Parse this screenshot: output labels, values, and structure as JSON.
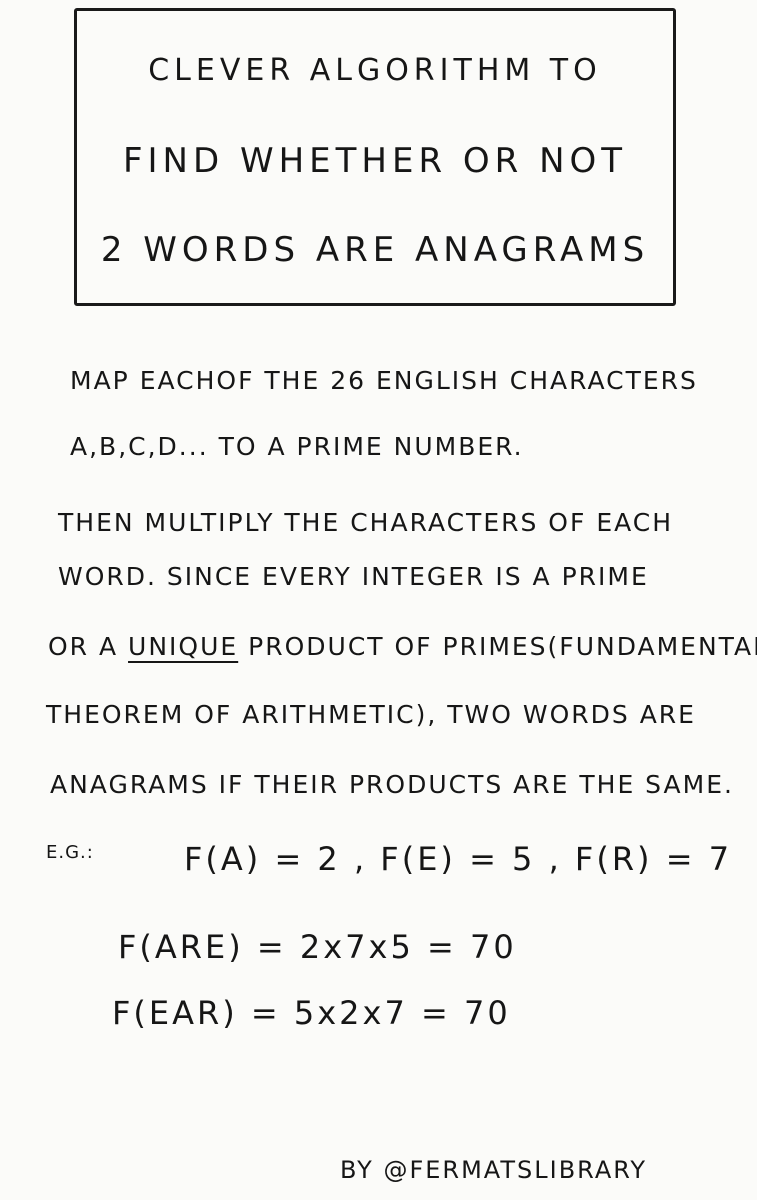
{
  "title": {
    "line1": "CLEVER ALGORITHM TO",
    "line2": "FIND WHETHER OR NOT",
    "line3": "2 WORDS ARE ANAGRAMS"
  },
  "body": {
    "line1": "MAP EACHOF THE 26 ENGLISH CHARACTERS",
    "line2": "A,B,C,D... TO A PRIME NUMBER.",
    "line3": "THEN MULTIPLY THE CHARACTERS OF EACH",
    "line4": "WORD. SINCE EVERY INTEGER IS A PRIME",
    "line5_before": "OR A ",
    "line5_underlined": "UNIQUE",
    "line5_after": " PRODUCT OF PRIMES(FUNDAMENTAL",
    "line6": "THEOREM OF ARITHMETIC), TWO WORDS ARE",
    "line7": "ANAGRAMS IF THEIR PRODUCTS ARE THE SAME."
  },
  "example": {
    "label": "E.G.:",
    "mapping": "F(A) = 2 , F(E) = 5 , F(R) = 7",
    "calc1": "F(ARE) = 2x7x5 = 70",
    "calc2": "F(EAR) = 5x2x7 = 70"
  },
  "signature": "BY @FERMATSLIBRARY"
}
